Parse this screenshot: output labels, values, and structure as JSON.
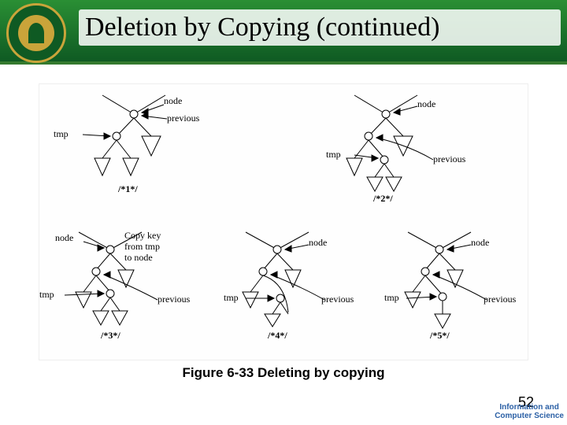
{
  "header": {
    "title": "Deletion by Copying (continued)"
  },
  "figure_caption": "Figure 6-33 Deleting by copying",
  "page_number": "52",
  "footer_text_top": "Information and",
  "footer_text_bottom": "Computer Science",
  "diagram": {
    "labels": {
      "node": "node",
      "previous": "previous",
      "tmp": "tmp",
      "copy": "Copy key\nfrom tmp\nto node"
    },
    "steps": [
      "/*1*/",
      "/*2*/",
      "/*3*/",
      "/*4*/",
      "/*5*/"
    ]
  }
}
